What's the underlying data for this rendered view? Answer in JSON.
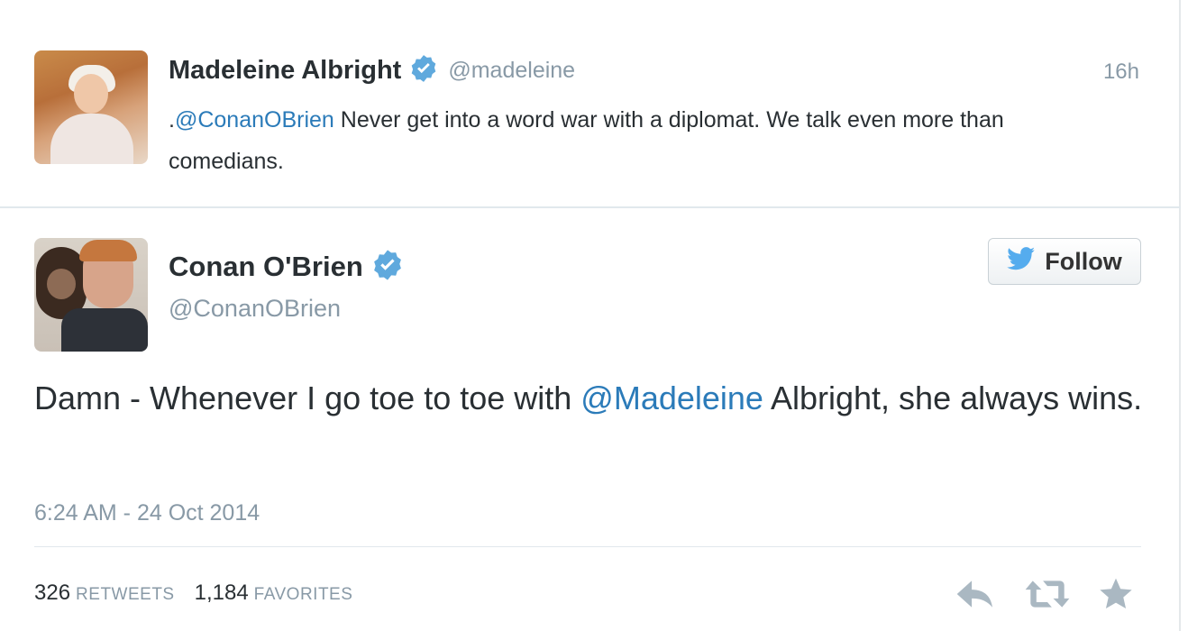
{
  "parent_tweet": {
    "display_name": "Madeleine Albright",
    "screen_name": "@madeleine",
    "time_ago": "16h",
    "text_prefix": ".",
    "mention": "@ConanOBrien",
    "text_rest": " Never get into a word war with a diplomat. We talk even more than comedians."
  },
  "main_tweet": {
    "display_name": "Conan O'Brien",
    "screen_name": "@ConanOBrien",
    "follow_label": "Follow",
    "text_before": "Damn - Whenever I go toe to toe with ",
    "mention": "@Madeleine",
    "text_after": " Albright, she always wins.",
    "timestamp": "6:24 AM - 24 Oct 2014",
    "retweets_count": "326",
    "retweets_label": "RETWEETS",
    "favorites_count": "1,184",
    "favorites_label": "FAVORITES"
  },
  "icons": [
    "verified-icon",
    "twitter-bird-icon",
    "reply-icon",
    "retweet-icon",
    "favorite-star-icon"
  ],
  "colors": {
    "link": "#2b7bb9",
    "verified": "#5fa9dd",
    "muted": "#8899a6",
    "twitter_blue": "#55acee"
  }
}
